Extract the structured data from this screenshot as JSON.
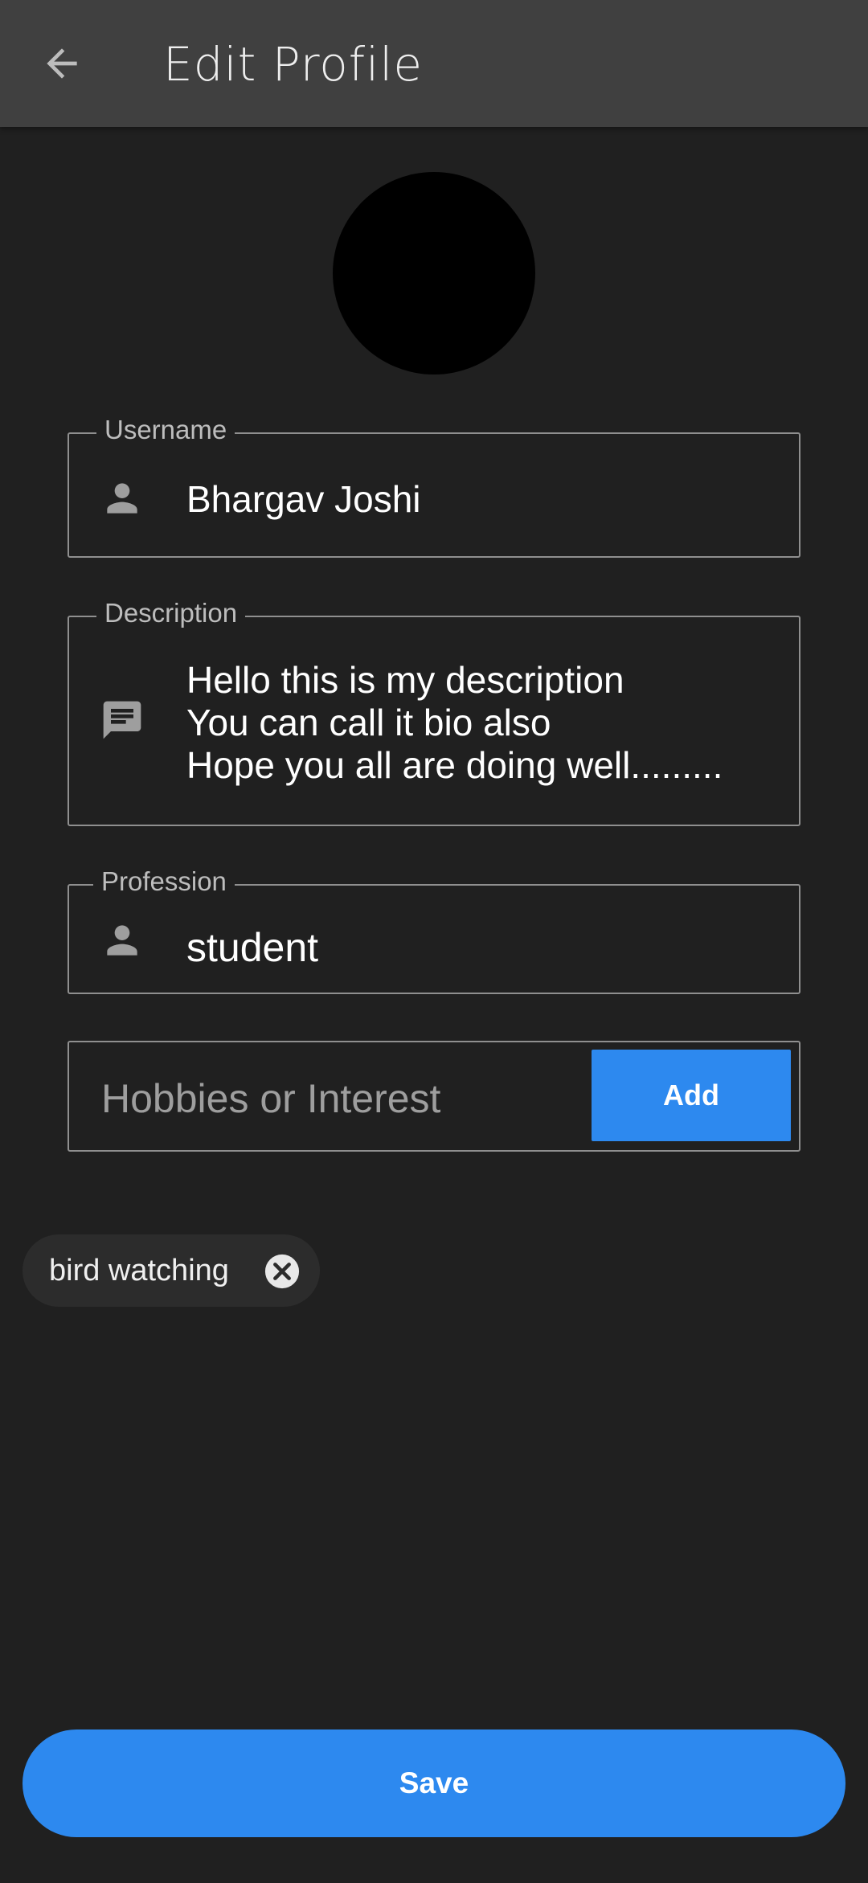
{
  "app_bar": {
    "title": "Edit Profile",
    "back_icon": "arrow-back-icon"
  },
  "avatar": {
    "color": "#000000"
  },
  "form": {
    "username": {
      "label": "Username",
      "value": "Bhargav Joshi",
      "icon": "person-icon"
    },
    "description": {
      "label": "Description",
      "value": "Hello this is my description\nYou can call it bio also\nHope you all are doing well.........",
      "icon": "chat-bubble-icon"
    },
    "profession": {
      "label": "Profession",
      "value": "student",
      "icon": "person-icon"
    },
    "hobby": {
      "placeholder": "Hobbies or Interest",
      "value": "",
      "add_label": "Add"
    }
  },
  "hobbies": [
    {
      "label": "bird watching",
      "delete_icon": "close-circle-icon"
    }
  ],
  "save_label": "Save",
  "colors": {
    "accent": "#2d89ef",
    "background": "#202020",
    "app_bar": "#404040"
  }
}
